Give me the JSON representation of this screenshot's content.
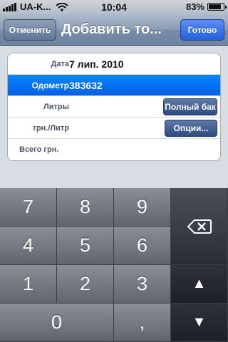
{
  "status": {
    "carrier": "UA-K...",
    "time": "10:04",
    "battery": "83%",
    "battery_level": 0.83
  },
  "navbar": {
    "cancel_label": "Отменить",
    "title": "Добавить то...",
    "done_label": "Готово"
  },
  "form": {
    "rows": [
      {
        "label": "Дата",
        "value": "7 лип. 2010"
      },
      {
        "label": "Одометр",
        "value": "383632"
      },
      {
        "label": "Литры",
        "button": "Полный бак"
      },
      {
        "label": "грн./Литр",
        "button": "Опции..."
      },
      {
        "label": "Всего грн."
      }
    ]
  },
  "keypad": {
    "keys": [
      "7",
      "8",
      "9",
      "4",
      "5",
      "6",
      "1",
      "2",
      "3",
      "0",
      ","
    ],
    "up_arrow": "▲",
    "down_arrow": "▼"
  },
  "colors": {
    "selected_row": "#0a84ff",
    "done_button": "#2460e0",
    "nav_bar": "#7a8ca7"
  },
  "icons": [
    "signal-icon",
    "wifi-icon",
    "battery-icon",
    "backspace-icon",
    "up-arrow-icon",
    "down-arrow-icon"
  ]
}
